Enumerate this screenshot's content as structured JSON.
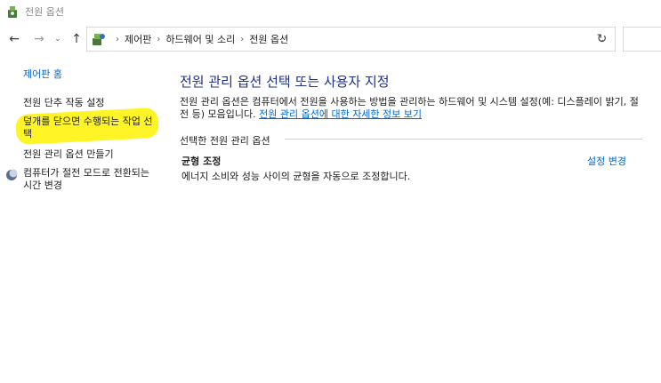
{
  "window": {
    "title": "전원 옵션"
  },
  "breadcrumb": {
    "items": [
      "제어판",
      "하드웨어 및 소리",
      "전원 옵션"
    ]
  },
  "nav": {
    "back": "←",
    "forward": "→",
    "recent": "⌄",
    "up": "↑",
    "dropdown": "⌄",
    "refresh": "↻"
  },
  "sidebar": {
    "home": "제어판 홈",
    "items": [
      "전원 단추 작동 설정",
      "덮개를 닫으면 수행되는 작업 선택",
      "전원 관리 옵션 만들기",
      "컴퓨터가 절전 모드로 전환되는 시간 변경"
    ]
  },
  "main": {
    "title": "전원 관리 옵션 선택 또는 사용자 지정",
    "description": "전원 관리 옵션은 컴퓨터에서 전원을 사용하는 방법을 관리하는 하드웨어 및 시스템 설정(예: 디스플레이 밝기, 절전 등) 모음입니다.",
    "more_info_link": "전원 관리 옵션에 대한 자세한 정보 보기",
    "section_label": "선택한 전원 관리 옵션",
    "plan": {
      "name": "균형 조정",
      "description": "에너지 소비와 성능 사이의 균형을 자동으로 조정합니다.",
      "change_link": "설정 변경"
    }
  },
  "colors": {
    "link": "#0066cc",
    "title": "#1e3287",
    "highlight": "#fff200"
  },
  "icons": {
    "app": "power-options-icon",
    "address": "control-panel-icon",
    "sleep": "moon-icon"
  }
}
